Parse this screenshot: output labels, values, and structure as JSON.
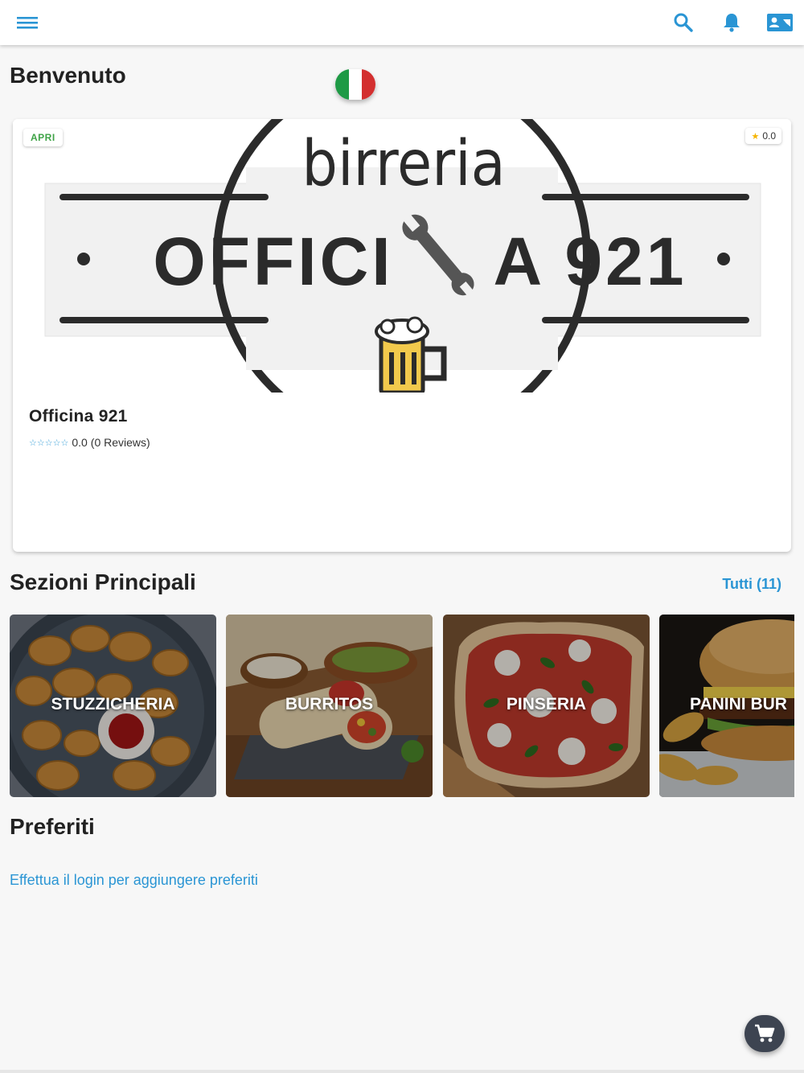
{
  "header": {
    "menu_icon": "menu-icon",
    "search_icon": "search-icon",
    "notifications_icon": "bell-icon",
    "account_icon": "contact-card-icon",
    "accent_color": "#2a95d4"
  },
  "welcome": {
    "title": "Benvenuto",
    "language_flag": "italy-flag-icon"
  },
  "restaurant": {
    "status_badge": "APRI",
    "rating_badge": "0.0",
    "name": "Officina 921",
    "rating_value": "0.0",
    "reviews_text": "(0 Reviews)",
    "stars": "☆☆☆☆☆",
    "logo": {
      "line1": "birreria",
      "line2_left": "OFFICI",
      "line2_right": "A 921",
      "wrench_icon": "wrench-icon",
      "beer_icon": "beer-mug-icon"
    }
  },
  "sections": {
    "title": "Sezioni Principali",
    "see_all": "Tutti (11)",
    "items": [
      {
        "label": "STUZZICHERIA"
      },
      {
        "label": "BURRITOS"
      },
      {
        "label": "PINSERIA"
      },
      {
        "label": "PANINI BUR"
      }
    ]
  },
  "favorites": {
    "title": "Preferiti",
    "login_prompt": "Effettua il login per aggiungere preferiti"
  },
  "cart": {
    "icon": "shopping-cart-icon"
  }
}
